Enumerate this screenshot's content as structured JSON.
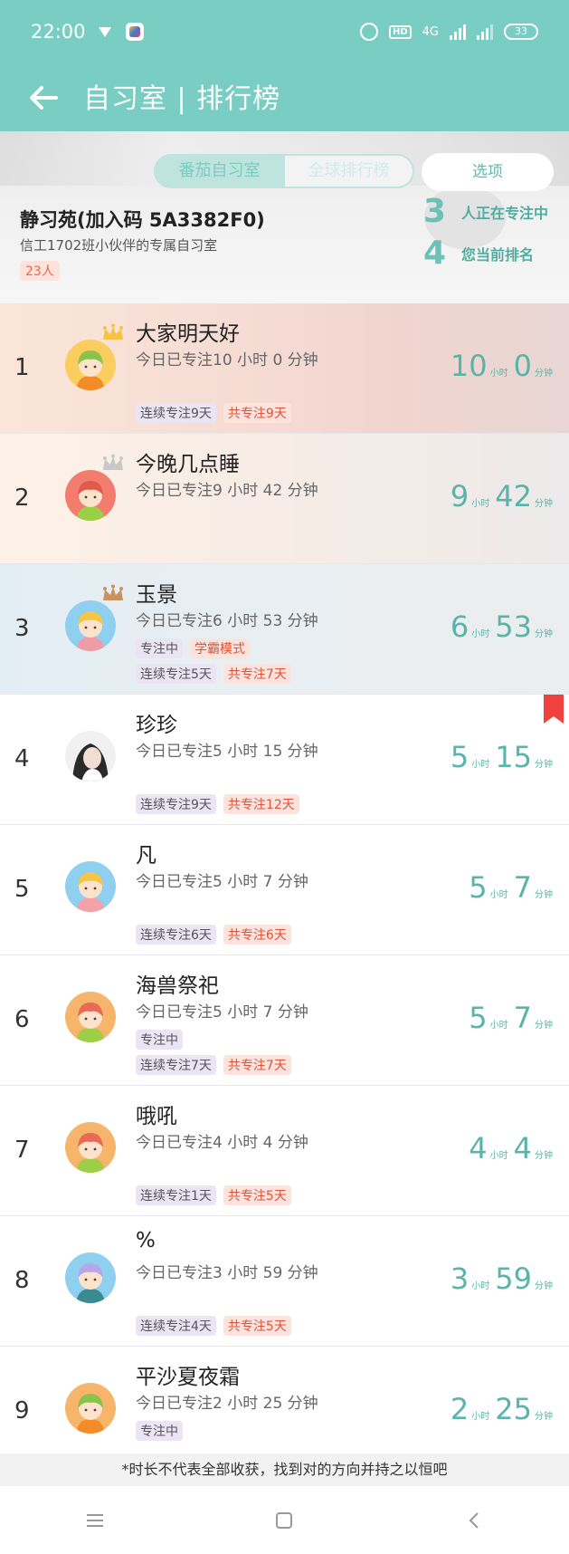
{
  "status": {
    "time": "22:00",
    "hd": "HD",
    "network": "4G",
    "battery": "33"
  },
  "appbar": {
    "title": "自习室 | 排行榜"
  },
  "tabs": {
    "tomato_room": "番茄自习室",
    "global_rank": "全球排行榜",
    "options": "选项"
  },
  "room": {
    "name": "静习苑(加入码 5A3382F0)",
    "description": "信工1702班小伙伴的专属自习室",
    "member_count": "23人",
    "focusing_num": "3",
    "focusing_label": "人正在专注中",
    "my_rank_num": "4",
    "my_rank_label": "您当前排名"
  },
  "units": {
    "hour": "小时",
    "minute": "分钟"
  },
  "colors": {
    "accent": "#79cdc2",
    "gold": "#f6c344",
    "silver": "#c8c8c8",
    "bronze": "#c8935e",
    "bookmark": "#f0413f"
  },
  "rows": [
    {
      "rank": "1",
      "name": "大家明天好",
      "today": "今日已专注10 小时 0 分钟",
      "hours": "10",
      "minutes": "0",
      "tags1": [],
      "tags2": [
        {
          "text": "连续专注9天",
          "kind": "purple"
        },
        {
          "text": "共专注9天",
          "kind": "red"
        }
      ],
      "crown": "gold-crown-icon"
    },
    {
      "rank": "2",
      "name": "今晚几点睡",
      "today": "今日已专注9 小时 42 分钟",
      "hours": "9",
      "minutes": "42",
      "tags1": [],
      "tags2": [],
      "crown": "silver-crown-icon"
    },
    {
      "rank": "3",
      "name": "玉景",
      "today": "今日已专注6 小时 53 分钟",
      "hours": "6",
      "minutes": "53",
      "tags1": [
        {
          "text": "专注中",
          "kind": "purple"
        },
        {
          "text": "学霸模式",
          "kind": "red"
        }
      ],
      "tags2": [
        {
          "text": "连续专注5天",
          "kind": "purple"
        },
        {
          "text": "共专注7天",
          "kind": "red"
        }
      ],
      "crown": "bronze-crown-icon"
    },
    {
      "rank": "4",
      "name": "珍珍",
      "today": "今日已专注5 小时 15 分钟",
      "hours": "5",
      "minutes": "15",
      "tags1": [],
      "tags2": [
        {
          "text": "连续专注9天",
          "kind": "purple"
        },
        {
          "text": "共专注12天",
          "kind": "red"
        }
      ],
      "crown": ""
    },
    {
      "rank": "5",
      "name": "凡",
      "today": "今日已专注5 小时 7 分钟",
      "hours": "5",
      "minutes": "7",
      "tags1": [],
      "tags2": [
        {
          "text": "连续专注6天",
          "kind": "purple"
        },
        {
          "text": "共专注6天",
          "kind": "red"
        }
      ],
      "crown": ""
    },
    {
      "rank": "6",
      "name": "海兽祭祀",
      "today": "今日已专注5 小时 7 分钟",
      "hours": "5",
      "minutes": "7",
      "tags1": [
        {
          "text": "专注中",
          "kind": "purple"
        }
      ],
      "tags2": [
        {
          "text": "连续专注7天",
          "kind": "purple"
        },
        {
          "text": "共专注7天",
          "kind": "red"
        }
      ],
      "crown": ""
    },
    {
      "rank": "7",
      "name": "哦吼",
      "today": "今日已专注4 小时 4 分钟",
      "hours": "4",
      "minutes": "4",
      "tags1": [],
      "tags2": [
        {
          "text": "连续专注1天",
          "kind": "purple"
        },
        {
          "text": "共专注5天",
          "kind": "red"
        }
      ],
      "crown": ""
    },
    {
      "rank": "8",
      "name": "%",
      "today": "今日已专注3 小时 59 分钟",
      "hours": "3",
      "minutes": "59",
      "tags1": [],
      "tags2": [
        {
          "text": "连续专注4天",
          "kind": "purple"
        },
        {
          "text": "共专注5天",
          "kind": "red"
        }
      ],
      "crown": ""
    },
    {
      "rank": "9",
      "name": "平沙夏夜霜",
      "today": "今日已专注2 小时 25 分钟",
      "hours": "2",
      "minutes": "25",
      "tags1": [
        {
          "text": "专注中",
          "kind": "purple"
        }
      ],
      "tags2": [],
      "crown": ""
    }
  ],
  "footer": {
    "note": "*时长不代表全部收获，找到对的方向并持之以恒吧"
  }
}
